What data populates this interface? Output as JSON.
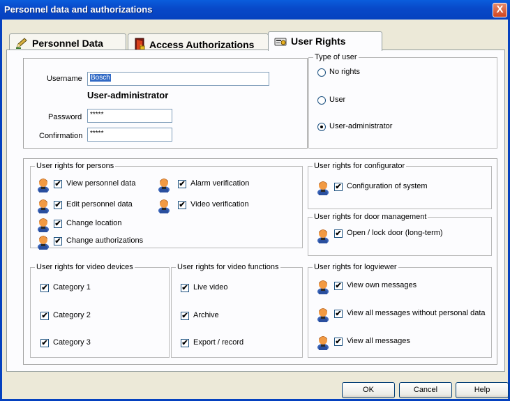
{
  "window": {
    "title": "Personnel data and authorizations",
    "close_glyph": "X"
  },
  "tabs": [
    {
      "label": "Personnel Data",
      "icon": "pencil-icon"
    },
    {
      "label": "Access Authorizations",
      "icon": "door-icon"
    },
    {
      "label": "User Rights",
      "icon": "key-card-icon",
      "active": true
    }
  ],
  "login": {
    "username_label": "Username",
    "username_value": "Bosch",
    "role": "User-administrator",
    "password_label": "Password",
    "password_value": "*****",
    "confirmation_label": "Confirmation",
    "confirmation_value": "*****"
  },
  "type_of_user": {
    "legend": "Type of user",
    "options": [
      {
        "label": "No rights",
        "selected": false
      },
      {
        "label": "User",
        "selected": false
      },
      {
        "label": "User-administrator",
        "selected": true
      }
    ]
  },
  "persons": {
    "legend": "User rights for persons",
    "items": [
      {
        "label": "View personnel data",
        "checked": true
      },
      {
        "label": "Edit personnel data",
        "checked": true
      },
      {
        "label": "Change location",
        "checked": true
      },
      {
        "label": "Change authorizations",
        "checked": true
      },
      {
        "label": "Alarm verification",
        "checked": true
      },
      {
        "label": "Video verification",
        "checked": true
      }
    ]
  },
  "configurator": {
    "legend": "User rights for configurator",
    "items": [
      {
        "label": "Configuration of system",
        "checked": true
      }
    ]
  },
  "door_management": {
    "legend": "User rights for door management",
    "items": [
      {
        "label": "Open / lock door (long-term)",
        "checked": true
      }
    ]
  },
  "video_devices": {
    "legend": "User rights for video devices",
    "items": [
      {
        "label": "Category 1",
        "checked": true
      },
      {
        "label": "Category 2",
        "checked": true
      },
      {
        "label": "Category 3",
        "checked": true
      }
    ]
  },
  "video_functions": {
    "legend": "User rights for video functions",
    "items": [
      {
        "label": "Live video",
        "checked": true
      },
      {
        "label": "Archive",
        "checked": true
      },
      {
        "label": "Export / record",
        "checked": true
      }
    ]
  },
  "logviewer": {
    "legend": "User rights for logviewer",
    "items": [
      {
        "label": "View own messages",
        "checked": true
      },
      {
        "label": "View all messages without personal data",
        "checked": true
      },
      {
        "label": "View all messages",
        "checked": true
      }
    ]
  },
  "buttons": {
    "ok": "OK",
    "cancel": "Cancel",
    "help": "Help"
  },
  "check_glyph": "✔",
  "colors": {
    "title_bar": "#0848c8",
    "selection": "#316ac5",
    "dialog_bg": "#ece9d8"
  }
}
